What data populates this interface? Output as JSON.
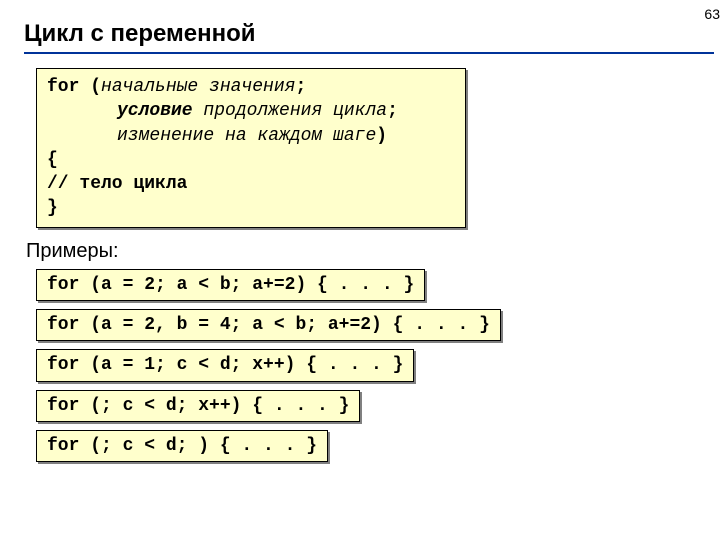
{
  "page_number": "63",
  "title": "Цикл с переменной",
  "syntax": {
    "for_kw": "for",
    "open": " (",
    "part1": "начальные значения",
    "sep": ";",
    "indent": "",
    "part2a": "условие",
    "part2b": " продолжения цикла",
    "part3": "изменение на каждом шаге",
    "close": ")",
    "brace_open": "{",
    "body": "// тело цикла",
    "brace_close": "}"
  },
  "examples_label": "Примеры:",
  "examples": {
    "e1": "for (a = 2; a < b; a+=2) { . . . }",
    "e2": "for (a = 2, b = 4; a < b; a+=2) { . . . }",
    "e3": "for (a = 1; c < d; x++) { . . . }",
    "e4": "for (; c < d; x++) { . . . }",
    "e5": "for (; c < d; ) { . . . }"
  }
}
